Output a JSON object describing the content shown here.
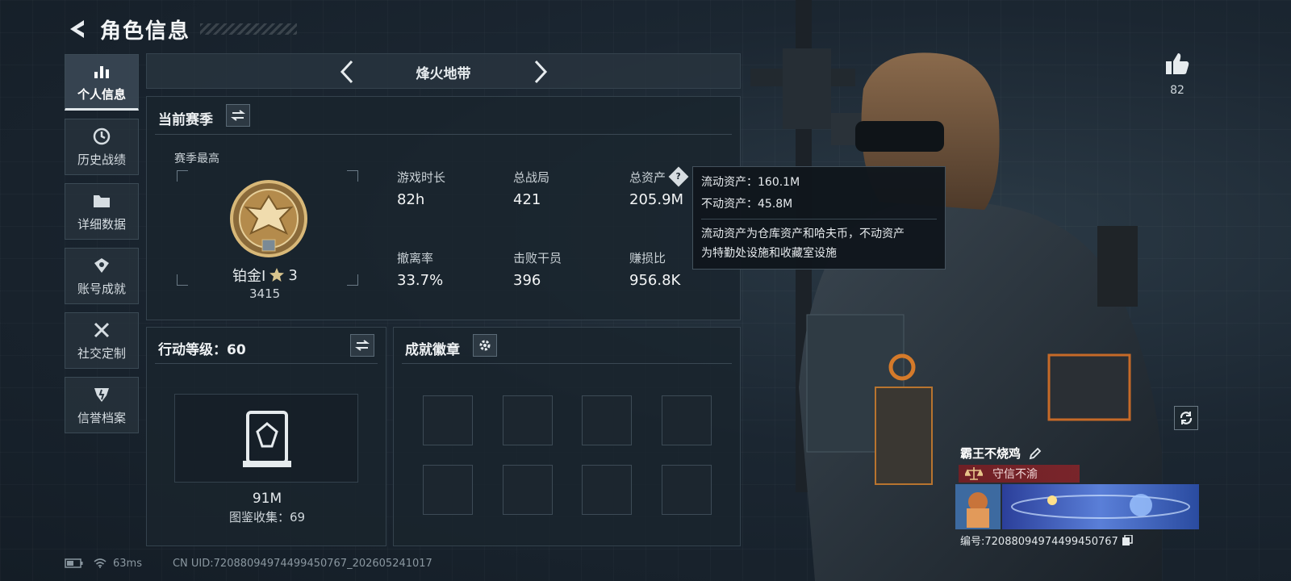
{
  "header": {
    "title": "角色信息"
  },
  "sidebar": {
    "items": [
      {
        "label": "个人信息",
        "icon": "bar-chart-icon",
        "active": true
      },
      {
        "label": "历史战绩",
        "icon": "clock-history-icon",
        "active": false
      },
      {
        "label": "详细数据",
        "icon": "folder-icon",
        "active": false
      },
      {
        "label": "账号成就",
        "icon": "achievement-icon",
        "active": false
      },
      {
        "label": "社交定制",
        "icon": "tools-icon",
        "active": false
      },
      {
        "label": "信誉档案",
        "icon": "credit-shield-icon",
        "active": false
      }
    ]
  },
  "mode": {
    "title": "烽火地带"
  },
  "season": {
    "title": "当前赛季",
    "best_label": "赛季最高",
    "rank_name": "铂金I",
    "rank_stars": "3",
    "rank_score": "3415",
    "stats": [
      {
        "label": "游戏时长",
        "value": "82h"
      },
      {
        "label": "总战局",
        "value": "421"
      },
      {
        "label": "总资产",
        "value": "205.9M"
      },
      {
        "label": "撤离率",
        "value": "33.7%"
      },
      {
        "label": "击败干员",
        "value": "396"
      },
      {
        "label": "赚损比",
        "value": "956.8K"
      }
    ]
  },
  "tooltip": {
    "liquid": "流动资产：160.1M",
    "fixed": "不动资产：45.8M",
    "desc_line1": "流动资产为仓库资产和哈夫币，不动资产",
    "desc_line2": "为特勤处设施和收藏室设施"
  },
  "action_level": {
    "title": "行动等级：60",
    "collection_value": "91M",
    "collection_label": "图鉴收集：69"
  },
  "badges": {
    "title": "成就徽章",
    "slots": 8
  },
  "like": {
    "count": "82"
  },
  "profile": {
    "name": "霸王不烧鸡",
    "honor": "守信不渝",
    "uid_line": "编号:72088094974499450767"
  },
  "footer": {
    "ping": "63ms",
    "uid": "CN UID:72088094974499450767_202605241017"
  },
  "colors": {
    "accent_gold": "#c9a25a",
    "honor_red": "#8e2429",
    "panel": "#1a242d"
  }
}
